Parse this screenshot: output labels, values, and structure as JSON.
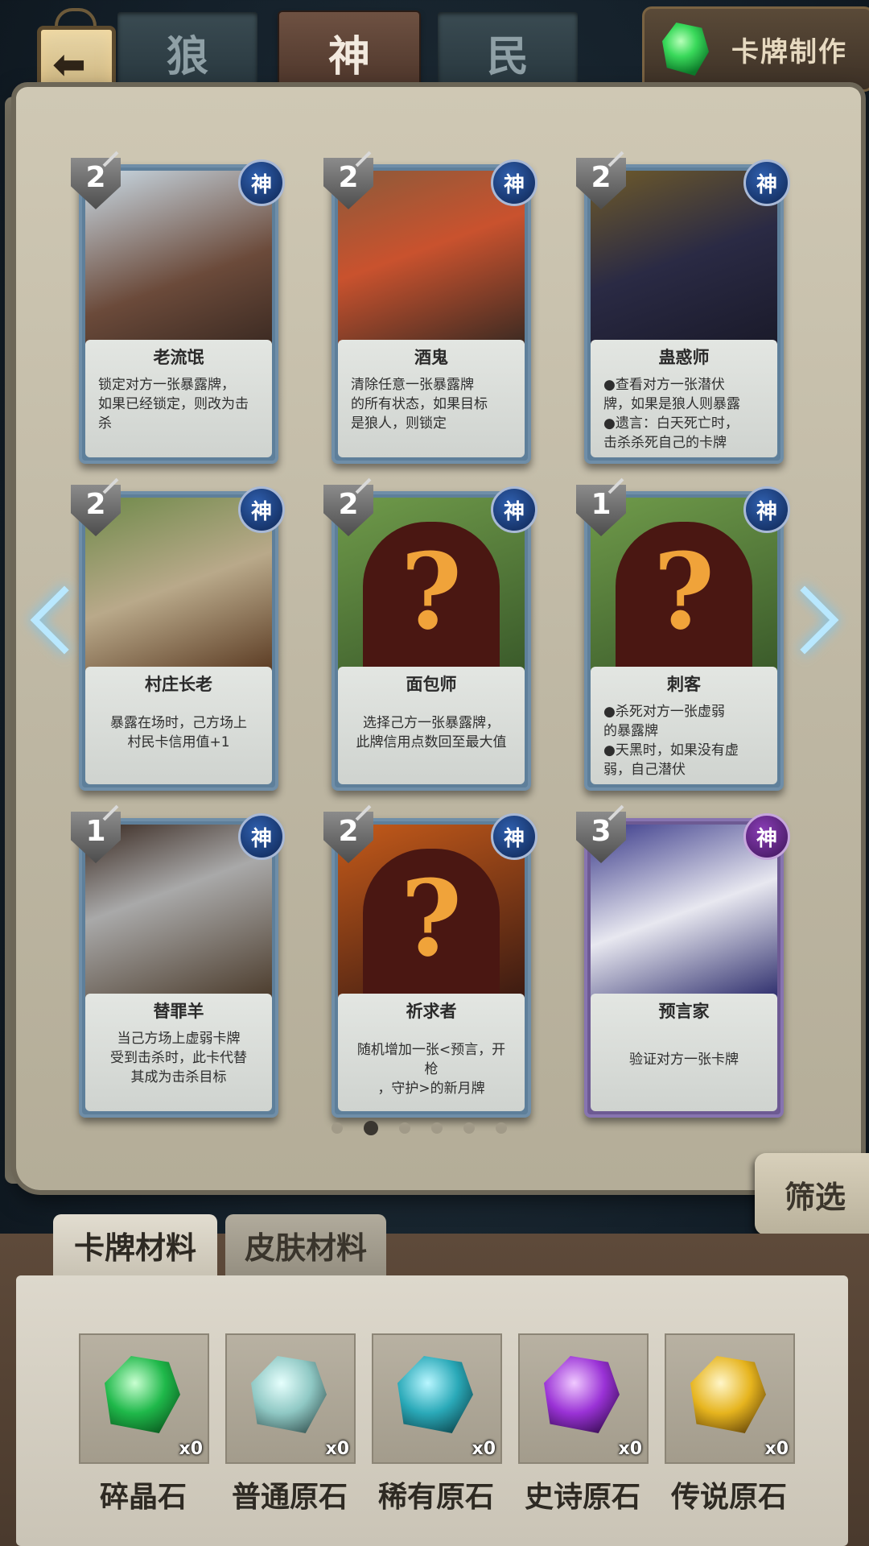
{
  "header": {
    "back_icon": "back-arrow-icon",
    "tabs": [
      {
        "label": "狼",
        "active": false
      },
      {
        "label": "神",
        "active": true
      },
      {
        "label": "民",
        "active": false
      }
    ],
    "craft_button": {
      "label": "卡牌制作",
      "icon": "green-crystal-icon"
    }
  },
  "cards": [
    {
      "name": "老流氓",
      "cost": "2",
      "faction": "神",
      "rarity": "rare",
      "desc": "锁定对方一张暴露牌，\n如果已经锁定，则改为击\n杀",
      "locked": false
    },
    {
      "name": "酒鬼",
      "cost": "2",
      "faction": "神",
      "rarity": "rare",
      "desc": "清除任意一张暴露牌\n的所有状态，如果目标\n是狼人，则锁定",
      "locked": false
    },
    {
      "name": "蛊惑师",
      "cost": "2",
      "faction": "神",
      "rarity": "rare",
      "desc": "●查看对方一张潜伏\n牌，如果是狼人则暴露\n●遗言：白天死亡时，\n击杀杀死自己的卡牌",
      "locked": false
    },
    {
      "name": "村庄长老",
      "cost": "2",
      "faction": "神",
      "rarity": "rare",
      "desc": "暴露在场时，己方场上\n村民卡信用值+1",
      "locked": false
    },
    {
      "name": "面包师",
      "cost": "2",
      "faction": "神",
      "rarity": "rare",
      "desc": "选择己方一张暴露牌，\n此牌信用点数回至最大值",
      "locked": true
    },
    {
      "name": "刺客",
      "cost": "1",
      "faction": "神",
      "rarity": "rare",
      "desc": "●杀死对方一张虚弱\n的暴露牌\n●天黑时，如果没有虚\n弱，自己潜伏",
      "locked": true
    },
    {
      "name": "替罪羊",
      "cost": "1",
      "faction": "神",
      "rarity": "rare",
      "desc": "当己方场上虚弱卡牌\n受到击杀时，此卡代替\n其成为击杀目标",
      "locked": false
    },
    {
      "name": "祈求者",
      "cost": "2",
      "faction": "神",
      "rarity": "rare",
      "desc": "随机增加一张<预言，开枪\n，守护>的新月牌",
      "locked": true
    },
    {
      "name": "预言家",
      "cost": "3",
      "faction": "神",
      "rarity": "epic",
      "desc": "验证对方一张卡牌",
      "locked": false
    }
  ],
  "pagination": {
    "total": 6,
    "current": 2
  },
  "filter_button": {
    "label": "筛选"
  },
  "materials": {
    "tabs": [
      {
        "label": "卡牌材料",
        "active": true
      },
      {
        "label": "皮肤材料",
        "active": false
      }
    ],
    "items": [
      {
        "label": "碎晶石",
        "count": "x0",
        "color": "#1fb84a"
      },
      {
        "label": "普通原石",
        "count": "x0",
        "color": "#8fc8c4"
      },
      {
        "label": "稀有原石",
        "count": "x0",
        "color": "#2aa9b8"
      },
      {
        "label": "史诗原石",
        "count": "x0",
        "color": "#9a32d6"
      },
      {
        "label": "传说原石",
        "count": "x0",
        "color": "#e6b41e"
      }
    ]
  }
}
